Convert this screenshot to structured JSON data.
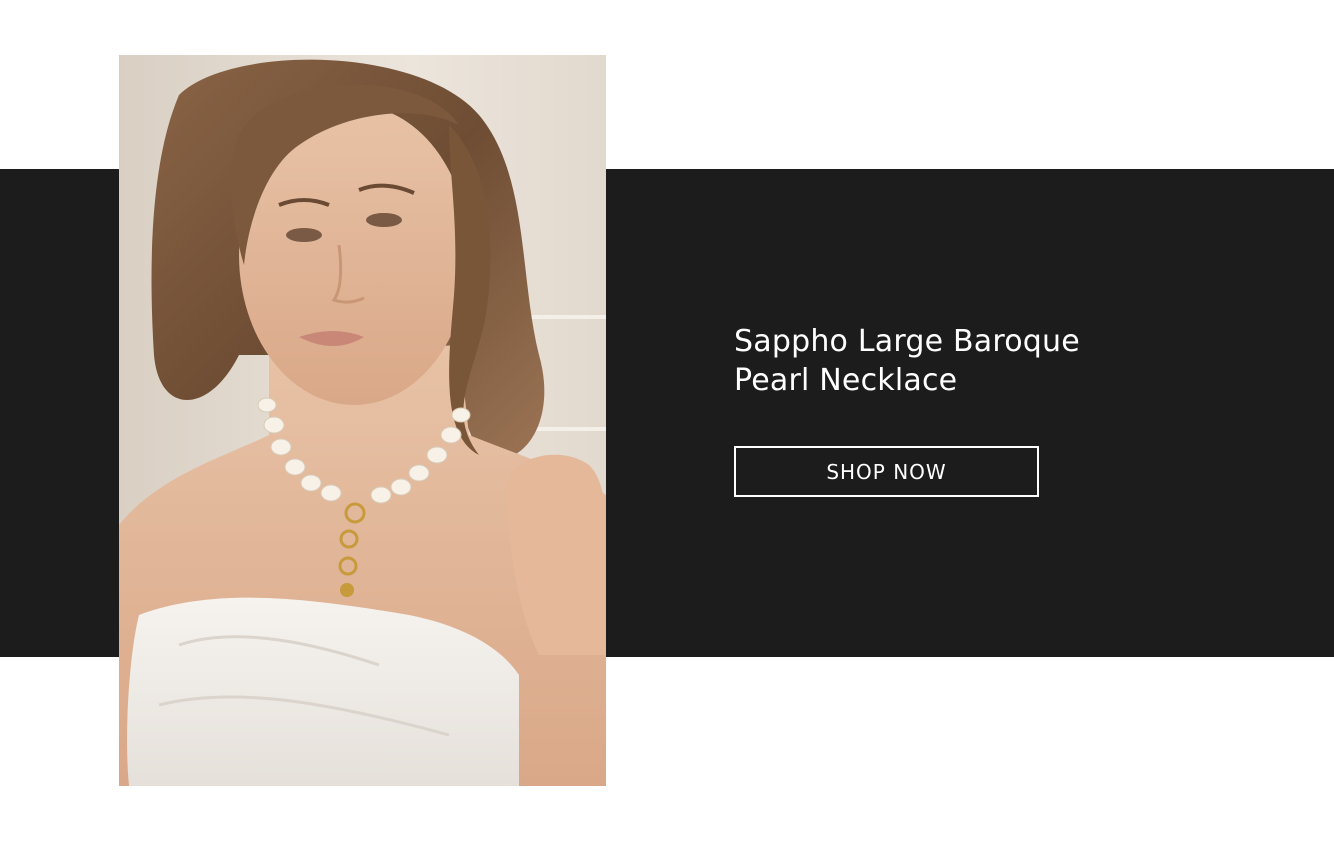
{
  "banner": {
    "title_line_1": "Sappho Large Baroque",
    "title_line_2": "Pearl Necklace",
    "cta_label": "SHOP NOW",
    "image_alt": "Model wearing the Sappho Large Baroque Pearl Necklace"
  },
  "colors": {
    "band": "#1c1c1c",
    "page_background": "#ffffff",
    "text": "#ffffff",
    "button_border": "#ffffff"
  }
}
